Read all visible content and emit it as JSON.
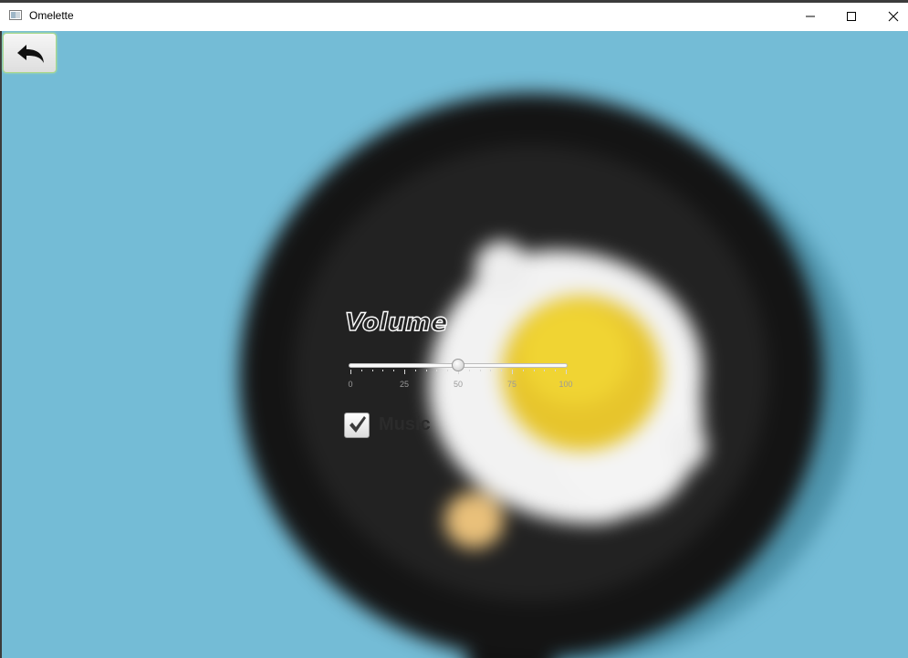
{
  "window": {
    "title": "Omelette"
  },
  "settings": {
    "volume_label": "Volume",
    "volume": {
      "value": 50,
      "min": 0,
      "max": 100,
      "tick_labels": [
        "0",
        "25",
        "50",
        "75",
        "100"
      ]
    },
    "music": {
      "label": "Music",
      "checked": true
    }
  },
  "icons": {
    "back": "back-arrow-icon",
    "app": "app-icon",
    "minimize": "minimize-icon",
    "maximize": "maximize-icon",
    "close": "close-icon"
  },
  "colors": {
    "background": "#74bcd6",
    "pan": "#141414",
    "egg_yolk": "#e7c52c",
    "back_button_border": "#a9d88a"
  }
}
